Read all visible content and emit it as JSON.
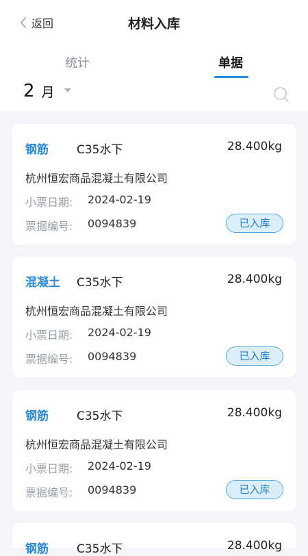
{
  "header": {
    "back_label": "返回",
    "title": "材料入库"
  },
  "tabs": [
    {
      "label": "统计",
      "active": false
    },
    {
      "label": "单据",
      "active": true
    }
  ],
  "filter": {
    "month": "2",
    "month_unit": "月"
  },
  "colors": {
    "accent": "#1e8ee6",
    "category": "#2a8ad9",
    "status_bg": "#ddeefb",
    "page_bg": "#f3f5f8"
  },
  "records": [
    {
      "category": "钢筋",
      "spec": "C35水下",
      "weight": "28.400kg",
      "company": "杭州恒宏商品混凝土有限公司",
      "date_label": "小票日期:",
      "date": "2024-02-19",
      "number_label": "票据编号:",
      "number": "0094839",
      "status": "已入库"
    },
    {
      "category": "混凝土",
      "spec": "C35水下",
      "weight": "28.400kg",
      "company": "杭州恒宏商品混凝土有限公司",
      "date_label": "小票日期:",
      "date": "2024-02-19",
      "number_label": "票据编号:",
      "number": "0094839",
      "status": "已入库"
    },
    {
      "category": "钢筋",
      "spec": "C35水下",
      "weight": "28.400kg",
      "company": "杭州恒宏商品混凝土有限公司",
      "date_label": "小票日期:",
      "date": "2024-02-19",
      "number_label": "票据编号:",
      "number": "0094839",
      "status": "已入库"
    },
    {
      "category": "钢筋",
      "spec": "C35水下",
      "weight": "28.400kg"
    }
  ]
}
